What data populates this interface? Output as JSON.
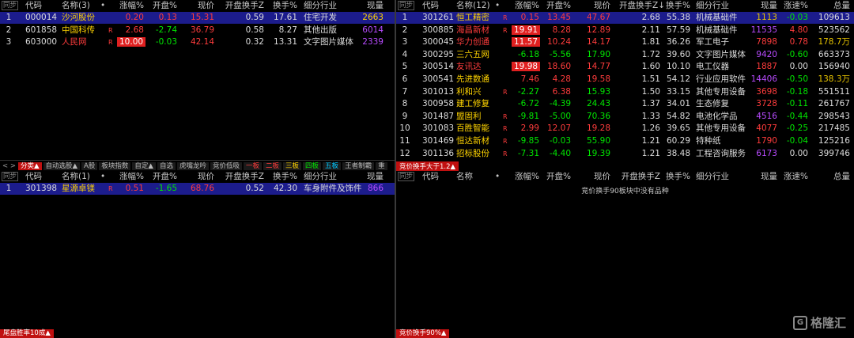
{
  "top_left": {
    "sync": "同步",
    "headers": [
      "代码",
      "名称(3)",
      "•",
      "涨幅%",
      "开盘%",
      "现价",
      "开盘换手Z",
      "换手%",
      "细分行业",
      "现量"
    ],
    "rows": [
      {
        "idx": "1",
        "code": "000014",
        "name": "沙河股份",
        "chg": "0.20",
        "open": "0.13",
        "price": "15.31",
        "openTurnover": "0.59",
        "turnover": "17.61",
        "industry": "住宅开发",
        "volume": "2663",
        "selected": true
      },
      {
        "idx": "2",
        "code": "601858",
        "name": "中国科传",
        "badge": "R",
        "chg": "2.68",
        "open": "-2.74",
        "price": "36.79",
        "openTurnover": "0.58",
        "turnover": "8.27",
        "industry": "其他出版",
        "volume": "6014"
      },
      {
        "idx": "3",
        "code": "603000",
        "name": "人民网",
        "badge": "R",
        "chg": "10.00",
        "open": "-0.03",
        "price": "42.14",
        "openTurnover": "0.32",
        "turnover": "13.31",
        "industry": "文字图片媒体",
        "volume": "2339"
      }
    ]
  },
  "tabs": [
    "分类▲",
    "自动选股▲",
    "A股",
    "板块指数",
    "自定▲",
    "自选",
    "虎嘴龙吟",
    "竞价低吸",
    "一板",
    "二板",
    "三板",
    "四板",
    "五板",
    "王者制霸",
    "重"
  ],
  "bottom_left": {
    "sync": "同步",
    "headers": [
      "代码",
      "名称(1)",
      "•",
      "涨幅%",
      "开盘%",
      "现价",
      "开盘换手Z",
      "换手%",
      "细分行业",
      "现量"
    ],
    "rows": [
      {
        "idx": "1",
        "code": "301398",
        "name": "星源卓镁",
        "badge": "R",
        "chg": "0.51",
        "open": "-1.65",
        "price": "68.76",
        "openTurnover": "0.52",
        "turnover": "42.30",
        "industry": "车身附件及饰件",
        "volume": "866",
        "selected": true
      }
    ],
    "footer_tab": "尾盘胜率10成▲"
  },
  "top_right": {
    "sync": "同步",
    "headers": [
      "代码",
      "名称(12)",
      "•",
      "涨幅%",
      "开盘%",
      "现价",
      "开盘换手Z↓",
      "换手%",
      "细分行业",
      "现量",
      "涨速%",
      "总量"
    ],
    "rows": [
      {
        "idx": "1",
        "code": "301261",
        "name": "恒工精密",
        "badge": "R",
        "chg": "0.15",
        "open": "13.45",
        "price": "47.67",
        "openTurnover": "2.68",
        "turnover": "55.38",
        "industry": "机械基础件",
        "volume": "1113",
        "speed": "-0.03",
        "total": "109613",
        "selected": true
      },
      {
        "idx": "2",
        "code": "300885",
        "name": "海昌新材",
        "badge": "R",
        "chg": "19.91",
        "open": "8.28",
        "price": "12.89",
        "openTurnover": "2.11",
        "turnover": "57.59",
        "industry": "机械基础件",
        "volume": "11535",
        "speed": "4.80",
        "total": "523562"
      },
      {
        "idx": "3",
        "code": "300045",
        "name": "华力创通",
        "chg": "11.57",
        "open": "10.24",
        "price": "14.17",
        "openTurnover": "1.81",
        "turnover": "36.26",
        "industry": "军工电子",
        "volume": "7898",
        "speed": "0.78",
        "total": "178.7万"
      },
      {
        "idx": "4",
        "code": "300295",
        "name": "三六五网",
        "chg": "-6.18",
        "open": "-5.56",
        "price": "17.90",
        "openTurnover": "1.72",
        "turnover": "39.60",
        "industry": "文字图片媒体",
        "volume": "9420",
        "speed": "-0.60",
        "total": "663373"
      },
      {
        "idx": "5",
        "code": "300514",
        "name": "友讯达",
        "chg": "19.98",
        "open": "18.60",
        "price": "14.77",
        "openTurnover": "1.60",
        "turnover": "10.10",
        "industry": "电工仪器",
        "volume": "1887",
        "speed": "0.00",
        "total": "156940"
      },
      {
        "idx": "6",
        "code": "300541",
        "name": "先进数通",
        "chg": "7.46",
        "open": "4.28",
        "price": "19.58",
        "openTurnover": "1.51",
        "turnover": "54.12",
        "industry": "行业应用软件",
        "volume": "14406",
        "speed": "-0.50",
        "total": "138.3万"
      },
      {
        "idx": "7",
        "code": "301013",
        "name": "利和兴",
        "badge": "R",
        "chg": "-2.27",
        "open": "6.38",
        "price": "15.93",
        "openTurnover": "1.50",
        "turnover": "33.15",
        "industry": "其他专用设备",
        "volume": "3698",
        "speed": "-0.18",
        "total": "551511"
      },
      {
        "idx": "8",
        "code": "300958",
        "name": "建工修复",
        "chg": "-6.72",
        "open": "-4.39",
        "price": "24.43",
        "openTurnover": "1.37",
        "turnover": "34.01",
        "industry": "生态修复",
        "volume": "3728",
        "speed": "-0.11",
        "total": "261767"
      },
      {
        "idx": "9",
        "code": "301487",
        "name": "盟固利",
        "badge": "R",
        "chg": "-9.81",
        "open": "-5.00",
        "price": "70.36",
        "openTurnover": "1.33",
        "turnover": "54.82",
        "industry": "电池化学品",
        "volume": "4516",
        "speed": "-0.44",
        "total": "298543"
      },
      {
        "idx": "10",
        "code": "301083",
        "name": "百胜智能",
        "badge": "R",
        "chg": "2.99",
        "open": "12.07",
        "price": "19.28",
        "openTurnover": "1.26",
        "turnover": "39.65",
        "industry": "其他专用设备",
        "volume": "4077",
        "speed": "-0.25",
        "total": "217485"
      },
      {
        "idx": "11",
        "code": "301469",
        "name": "恒达新材",
        "badge": "R",
        "chg": "-9.85",
        "open": "-0.03",
        "price": "55.90",
        "openTurnover": "1.21",
        "turnover": "60.29",
        "industry": "特种纸",
        "volume": "1790",
        "speed": "-0.04",
        "total": "125216"
      },
      {
        "idx": "12",
        "code": "301136",
        "name": "招标股份",
        "badge": "R",
        "chg": "-7.31",
        "open": "-4.40",
        "price": "19.39",
        "openTurnover": "1.21",
        "turnover": "38.48",
        "industry": "工程咨询服务",
        "volume": "6173",
        "speed": "0.00",
        "total": "399746"
      }
    ],
    "footer_tab": "竞价换手大于1.2▲"
  },
  "bottom_right": {
    "sync": "同步",
    "headers": [
      "代码",
      "名称",
      "•",
      "涨幅%",
      "开盘%",
      "现价",
      "开盘换手Z",
      "换手%",
      "细分行业",
      "现量",
      "涨速%",
      "总量"
    ],
    "empty_message": "竞价换手90板块中没有品种",
    "footer_tab": "竞价换手90%▲"
  },
  "watermark": "格隆汇",
  "colors": {
    "up": "#ff3c3c",
    "down": "#00e600",
    "selected": "#1c1c8c",
    "accent_tab": "#c01010"
  }
}
